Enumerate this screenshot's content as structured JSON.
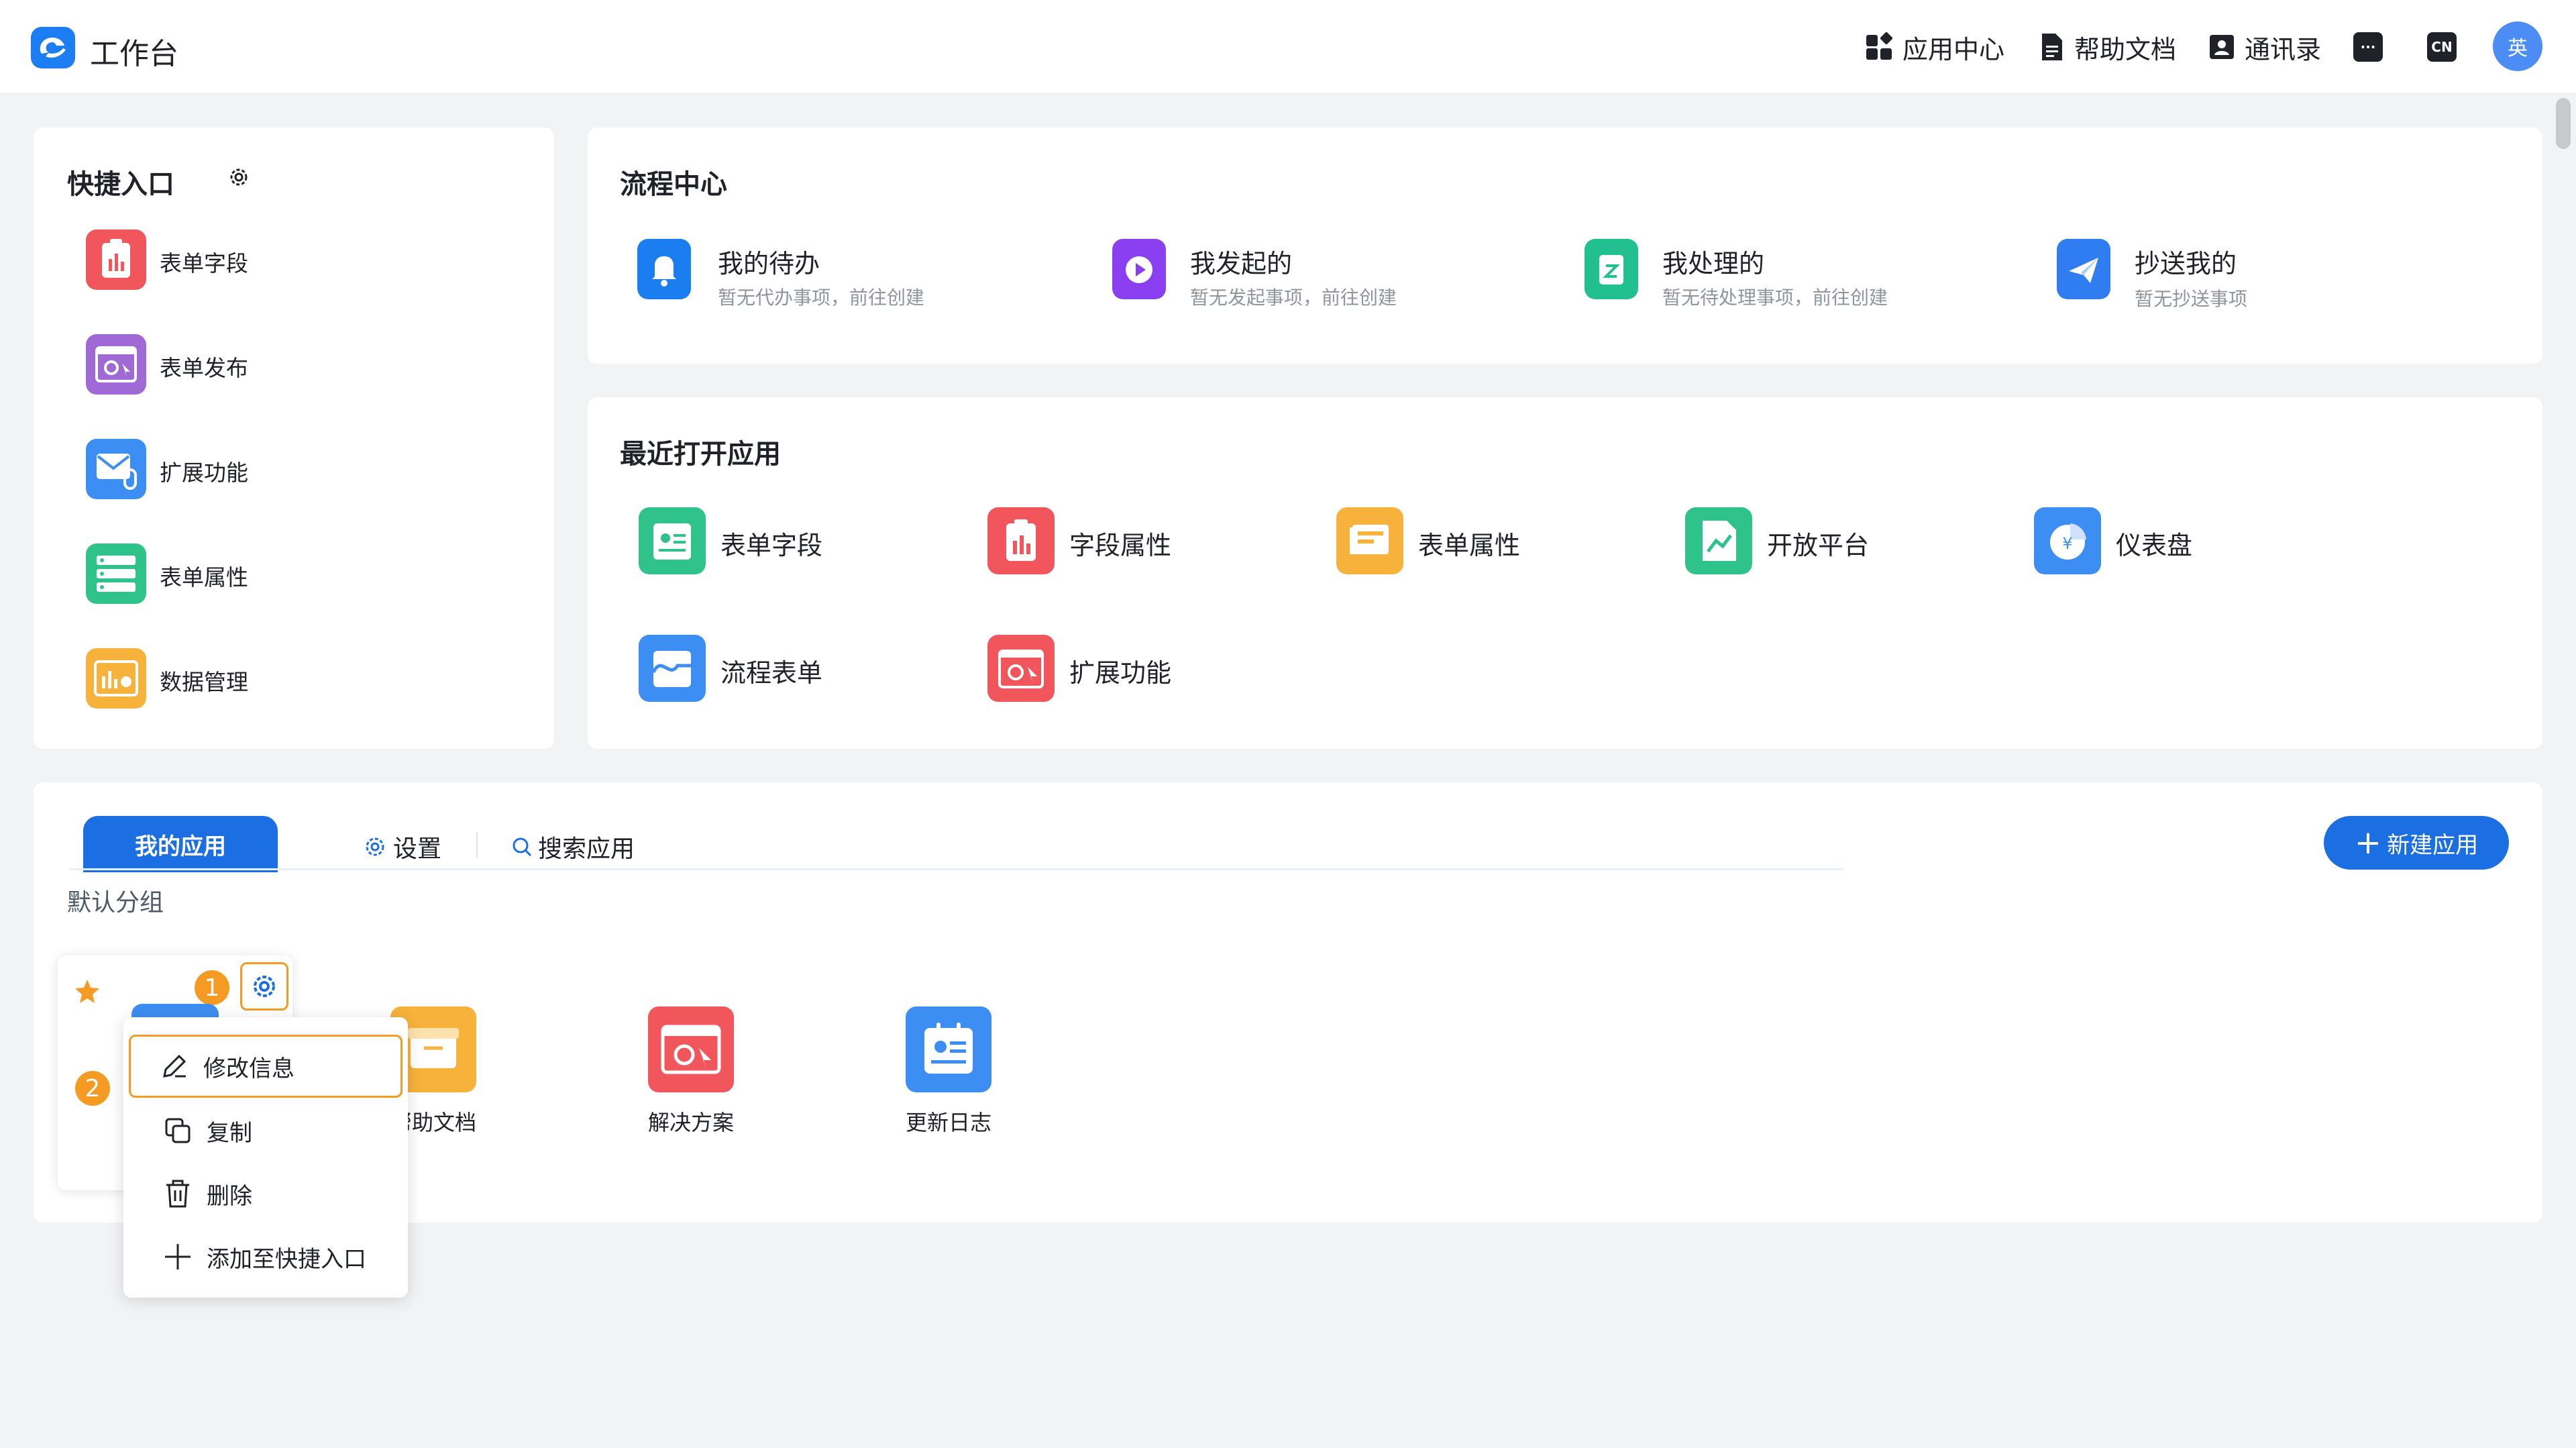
{
  "header": {
    "title": "工作台",
    "nav": [
      {
        "label": "应用中心",
        "icon": "app-grid-icon"
      },
      {
        "label": "帮助文档",
        "icon": "document-icon"
      },
      {
        "label": "通讯录",
        "icon": "contacts-icon"
      }
    ],
    "lang_badge": "CN",
    "avatar_text": "英"
  },
  "quick": {
    "title": "快捷入口",
    "items": [
      {
        "label": "表单字段",
        "color": "#f0565b"
      },
      {
        "label": "表单发布",
        "color": "#a06ad6"
      },
      {
        "label": "扩展功能",
        "color": "#3d8ef2"
      },
      {
        "label": "表单属性",
        "color": "#2fc28b"
      },
      {
        "label": "数据管理",
        "color": "#f7b23b"
      }
    ]
  },
  "flow": {
    "title": "流程中心",
    "items": [
      {
        "label": "我的待办",
        "sub": "暂无代办事项，前往创建",
        "color": "#1a7ef0"
      },
      {
        "label": "我发起的",
        "sub": "暂无发起事项，前往创建",
        "color": "#8a3ff0"
      },
      {
        "label": "我处理的",
        "sub": "暂无待处理事项，前往创建",
        "color": "#22c08e"
      },
      {
        "label": "抄送我的",
        "sub": "暂无抄送事项",
        "color": "#2f7df1"
      }
    ]
  },
  "recent": {
    "title": "最近打开应用",
    "items": [
      {
        "label": "表单字段",
        "color": "#2fc28b"
      },
      {
        "label": "字段属性",
        "color": "#f0565b"
      },
      {
        "label": "表单属性",
        "color": "#f7b23b"
      },
      {
        "label": "开放平台",
        "color": "#2fc28b"
      },
      {
        "label": "仪表盘",
        "color": "#3d8ef2"
      },
      {
        "label": "流程表单",
        "color": "#3d8ef2"
      },
      {
        "label": "扩展功能",
        "color": "#f0565b"
      }
    ]
  },
  "myapps": {
    "tab_active": "我的应用",
    "tab_settings": "设置",
    "tab_search": "搜索应用",
    "new_button": "新建应用",
    "group": "默认分组",
    "apps": [
      {
        "label": "帮助文档",
        "color": "#f7b23b"
      },
      {
        "label": "解决方案",
        "color": "#f0565b"
      },
      {
        "label": "更新日志",
        "color": "#3d8ef2"
      }
    ],
    "badge1": "1",
    "badge2": "2"
  },
  "context_menu": {
    "items": [
      "修改信息",
      "复制",
      "删除",
      "添加至快捷入口"
    ]
  }
}
